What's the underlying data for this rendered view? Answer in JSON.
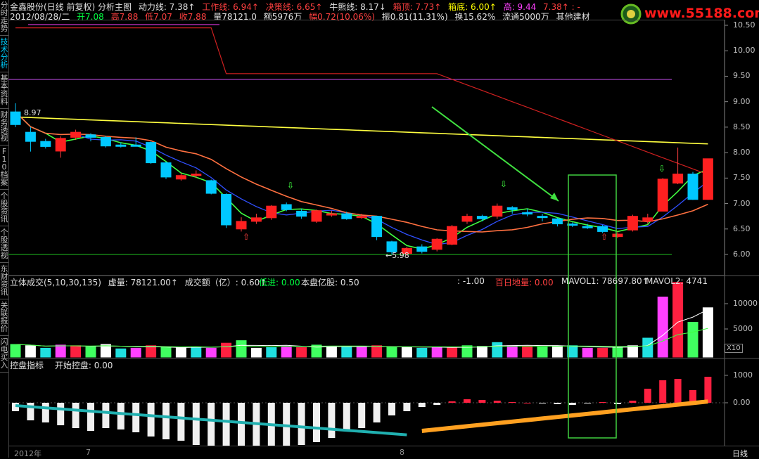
{
  "left_tabs": [
    {
      "label": "分时走势",
      "active": false
    },
    {
      "label": "技术分析",
      "active": true
    },
    {
      "label": "基本资料",
      "active": false
    },
    {
      "label": "财务透视",
      "active": false
    },
    {
      "label": "F10档案",
      "active": false
    },
    {
      "label": "个股资讯",
      "active": false
    },
    {
      "label": "个股透视",
      "active": false
    },
    {
      "label": "东财资讯",
      "active": false
    },
    {
      "label": "关联报价",
      "active": false
    },
    {
      "label": "闪电买入",
      "active": false
    }
  ],
  "header": {
    "stock": "金鑫股份(日线 前复权) 分析主图",
    "dongli": "动力线: 7.38↑",
    "gongzuo": "工作线: 6.94↑",
    "juece": "决策线: 6.65↑",
    "niuxiong": "牛熊线: 8.17↓",
    "xiangding": "箱顶: 7.73↑",
    "xiangdi": "箱底: 6.00↑",
    "gao": "高: 9.44",
    "extra": "7.38↑ : -"
  },
  "quote": {
    "date": "2012/08/28/二",
    "open": "开7.08",
    "high": "高7.88",
    "low": "低7.07",
    "close": "收7.88",
    "vol": "量78121.0",
    "amount": "额5976万",
    "change": "幅0.72(10.06%)",
    "amp": "振0.81(11.31%)",
    "turnover": "换15.62%",
    "float": "流通5000万",
    "sector": "其他建材"
  },
  "logo": {
    "text": "www.55188.com"
  },
  "price_axis": [
    "10.50",
    "10.00",
    "9.50",
    "9.00",
    "8.50",
    "8.00",
    "7.50",
    "7.00",
    "6.50",
    "6.00"
  ],
  "annotations": {
    "high_label": "8.97",
    "low_label": "←5.98"
  },
  "vol_header": {
    "title": "立体成交(5,10,30,135)",
    "xuliang": "虚量: 78121.00↑",
    "chengjiao": "成交额（亿）: 0.60↑",
    "dijin": "低进: 0.00",
    "benpan": "本盘亿股: 0.50",
    "neg": ": -1.00",
    "baiRi": "百日地量: 0.00",
    "mavol1": "MAVOL1: 78697.80↑",
    "mavol2": "MAVOL2: 4741"
  },
  "vol_axis": [
    "10000",
    "5000"
  ],
  "vol_scale": "X10",
  "ctl_header": {
    "title": "控盘指标",
    "value": "开始控盘: 0.00"
  },
  "ctl_axis": [
    "1000",
    "0.00"
  ],
  "bottom": {
    "year": "2012年",
    "m7": "7",
    "m8": "8",
    "period": "日线"
  },
  "colors": {
    "up": "#ff2020",
    "down": "#00c8ff",
    "ma_yellow": "#ffff40",
    "ma_green": "#40ff40"
  },
  "chart_data": {
    "type": "candlestick",
    "candles": [
      {
        "o": 8.55,
        "c": 8.8,
        "h": 8.97,
        "l": 8.5,
        "up": false
      },
      {
        "o": 8.4,
        "c": 8.22,
        "h": 8.5,
        "l": 8.02,
        "up": false
      },
      {
        "o": 8.22,
        "c": 8.12,
        "h": 8.27,
        "l": 8.08,
        "up": false
      },
      {
        "o": 8.03,
        "c": 8.28,
        "h": 8.32,
        "l": 7.9,
        "up": true
      },
      {
        "o": 8.3,
        "c": 8.4,
        "h": 8.45,
        "l": 8.25,
        "up": true
      },
      {
        "o": 8.35,
        "c": 8.3,
        "h": 8.38,
        "l": 8.22,
        "up": false
      },
      {
        "o": 8.3,
        "c": 8.13,
        "h": 8.33,
        "l": 8.1,
        "up": false
      },
      {
        "o": 8.15,
        "c": 8.15,
        "h": 8.2,
        "l": 8.1,
        "up": false
      },
      {
        "o": 8.15,
        "c": 8.15,
        "h": 8.3,
        "l": 8.12,
        "up": false
      },
      {
        "o": 8.2,
        "c": 7.8,
        "h": 8.22,
        "l": 7.78,
        "up": false
      },
      {
        "o": 7.8,
        "c": 7.52,
        "h": 7.82,
        "l": 7.48,
        "up": false
      },
      {
        "o": 7.55,
        "c": 7.48,
        "h": 7.6,
        "l": 7.45,
        "up": true
      },
      {
        "o": 7.58,
        "c": 7.55,
        "h": 7.65,
        "l": 7.5,
        "up": true
      },
      {
        "o": 7.45,
        "c": 7.2,
        "h": 7.47,
        "l": 7.18,
        "up": false
      },
      {
        "o": 7.18,
        "c": 6.58,
        "h": 7.2,
        "l": 6.52,
        "up": false
      },
      {
        "o": 6.5,
        "c": 6.65,
        "h": 6.73,
        "l": 6.45,
        "up": true
      },
      {
        "o": 6.65,
        "c": 6.72,
        "h": 6.8,
        "l": 6.6,
        "up": true
      },
      {
        "o": 6.72,
        "c": 6.95,
        "h": 6.97,
        "l": 6.68,
        "up": true
      },
      {
        "o": 6.88,
        "c": 6.98,
        "h": 7.02,
        "l": 6.85,
        "up": false
      },
      {
        "o": 6.85,
        "c": 6.75,
        "h": 6.9,
        "l": 6.7,
        "up": false
      },
      {
        "o": 6.65,
        "c": 6.86,
        "h": 6.88,
        "l": 6.62,
        "up": true
      },
      {
        "o": 6.8,
        "c": 6.8,
        "h": 6.86,
        "l": 6.74,
        "up": true
      },
      {
        "o": 6.8,
        "c": 6.7,
        "h": 6.84,
        "l": 6.68,
        "up": false
      },
      {
        "o": 6.75,
        "c": 6.75,
        "h": 6.8,
        "l": 6.7,
        "up": true
      },
      {
        "o": 6.75,
        "c": 6.35,
        "h": 6.76,
        "l": 6.28,
        "up": false
      },
      {
        "o": 6.25,
        "c": 6.05,
        "h": 6.27,
        "l": 6.0,
        "up": false
      },
      {
        "o": 6.02,
        "c": 6.12,
        "h": 6.15,
        "l": 5.98,
        "up": true
      },
      {
        "o": 6.06,
        "c": 6.15,
        "h": 6.2,
        "l": 6.02,
        "up": false
      },
      {
        "o": 6.1,
        "c": 6.3,
        "h": 6.32,
        "l": 6.06,
        "up": true
      },
      {
        "o": 6.2,
        "c": 6.55,
        "h": 6.58,
        "l": 6.18,
        "up": true
      },
      {
        "o": 6.65,
        "c": 6.75,
        "h": 6.8,
        "l": 6.6,
        "up": true
      },
      {
        "o": 6.75,
        "c": 6.7,
        "h": 6.78,
        "l": 6.65,
        "up": false
      },
      {
        "o": 6.75,
        "c": 6.95,
        "h": 7.0,
        "l": 6.7,
        "up": true
      },
      {
        "o": 6.88,
        "c": 6.92,
        "h": 6.95,
        "l": 6.8,
        "up": false
      },
      {
        "o": 6.82,
        "c": 6.82,
        "h": 6.9,
        "l": 6.75,
        "up": false
      },
      {
        "o": 6.75,
        "c": 6.75,
        "h": 6.8,
        "l": 6.65,
        "up": false
      },
      {
        "o": 6.7,
        "c": 6.6,
        "h": 6.72,
        "l": 6.55,
        "up": false
      },
      {
        "o": 6.6,
        "c": 6.58,
        "h": 6.63,
        "l": 6.54,
        "up": false
      },
      {
        "o": 6.55,
        "c": 6.55,
        "h": 6.6,
        "l": 6.5,
        "up": false
      },
      {
        "o": 6.55,
        "c": 6.45,
        "h": 6.58,
        "l": 6.42,
        "up": false
      },
      {
        "o": 6.4,
        "c": 6.35,
        "h": 6.45,
        "l": 6.32,
        "up": true
      },
      {
        "o": 6.48,
        "c": 6.75,
        "h": 6.78,
        "l": 6.45,
        "up": true
      },
      {
        "o": 6.72,
        "c": 6.65,
        "h": 6.8,
        "l": 6.6,
        "up": true
      },
      {
        "o": 6.85,
        "c": 7.48,
        "h": 7.5,
        "l": 6.85,
        "up": true
      },
      {
        "o": 7.4,
        "c": 7.58,
        "h": 8.1,
        "l": 7.38,
        "up": true
      },
      {
        "o": 7.08,
        "c": 7.58,
        "h": 7.62,
        "l": 7.07,
        "up": false
      },
      {
        "o": 7.08,
        "c": 7.88,
        "h": 7.88,
        "l": 7.07,
        "up": true
      }
    ],
    "volume": [
      20,
      18,
      14,
      19,
      18,
      16,
      20,
      13,
      14,
      18,
      15,
      15,
      16,
      14,
      22,
      26,
      14,
      15,
      16,
      15,
      19,
      17,
      16,
      16,
      18,
      16,
      15,
      14,
      16,
      15,
      18,
      17,
      23,
      18,
      17,
      16,
      17,
      18,
      14,
      14,
      15,
      18,
      30,
      95,
      118,
      55,
      78
    ],
    "control": [
      -1.2,
      -2.5,
      -2.8,
      -3.2,
      -3.6,
      -4.0,
      -3.6,
      -3.8,
      -4.2,
      -4.8,
      -5.2,
      -5.4,
      -6.0,
      -7.0,
      -8.8,
      -7.6,
      -6.8,
      -6.6,
      -6.2,
      -6.0,
      -5.6,
      -5.0,
      -4.0,
      -3.6,
      -2.8,
      -1.8,
      -1.2,
      -0.6,
      -0.3,
      0.2,
      0.5,
      0.4,
      0.3,
      0.1,
      0.0,
      -0.1,
      -0.2,
      -0.3,
      -0.1,
      0.1,
      -0.2,
      0.3,
      2.0,
      3.2,
      3.4,
      1.8,
      3.7
    ]
  }
}
